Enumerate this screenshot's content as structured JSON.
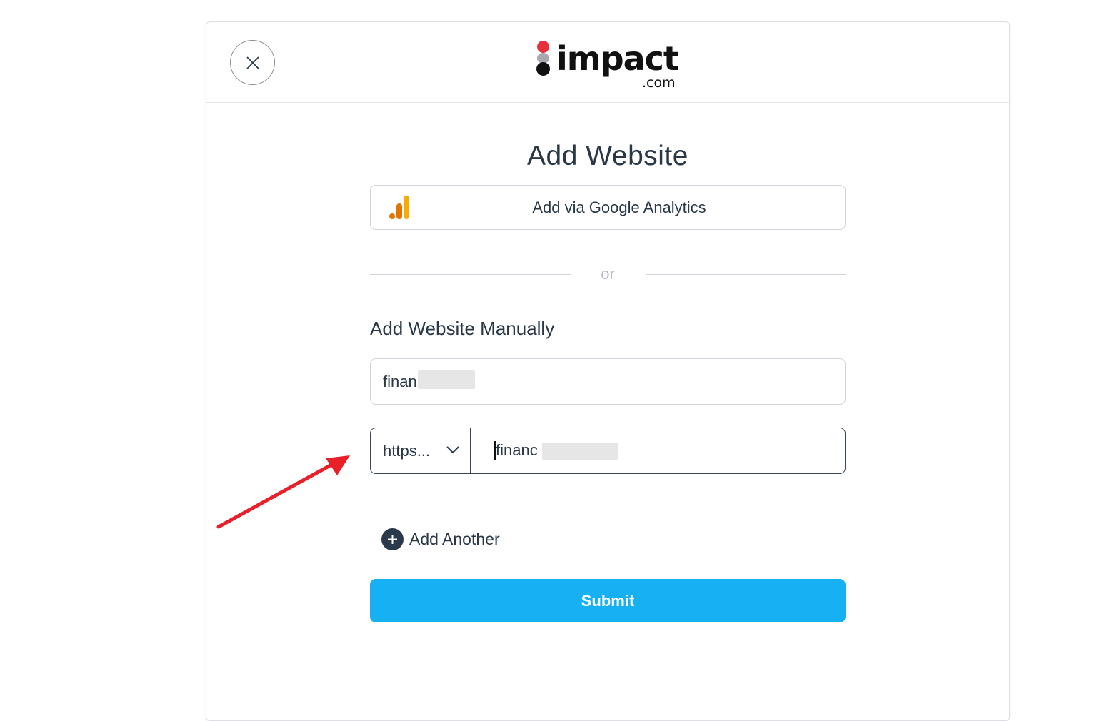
{
  "header": {
    "close_icon": "close-icon",
    "logo_text": "impact",
    "logo_suffix": ".com"
  },
  "page_title": "Add Website",
  "google_analytics": {
    "label": "Add via Google Analytics",
    "icon": "google-analytics-icon"
  },
  "separator_text": "or",
  "manual": {
    "heading": "Add Website Manually",
    "name_value": "finan",
    "protocol_value": "https...",
    "url_value": "financ"
  },
  "add_another_label": "Add Another",
  "submit_label": "Submit",
  "colors": {
    "accent": "#17b0f2",
    "text": "#2a3746",
    "annotation_arrow": "#e8202a",
    "logo_red": "#e8303c"
  }
}
